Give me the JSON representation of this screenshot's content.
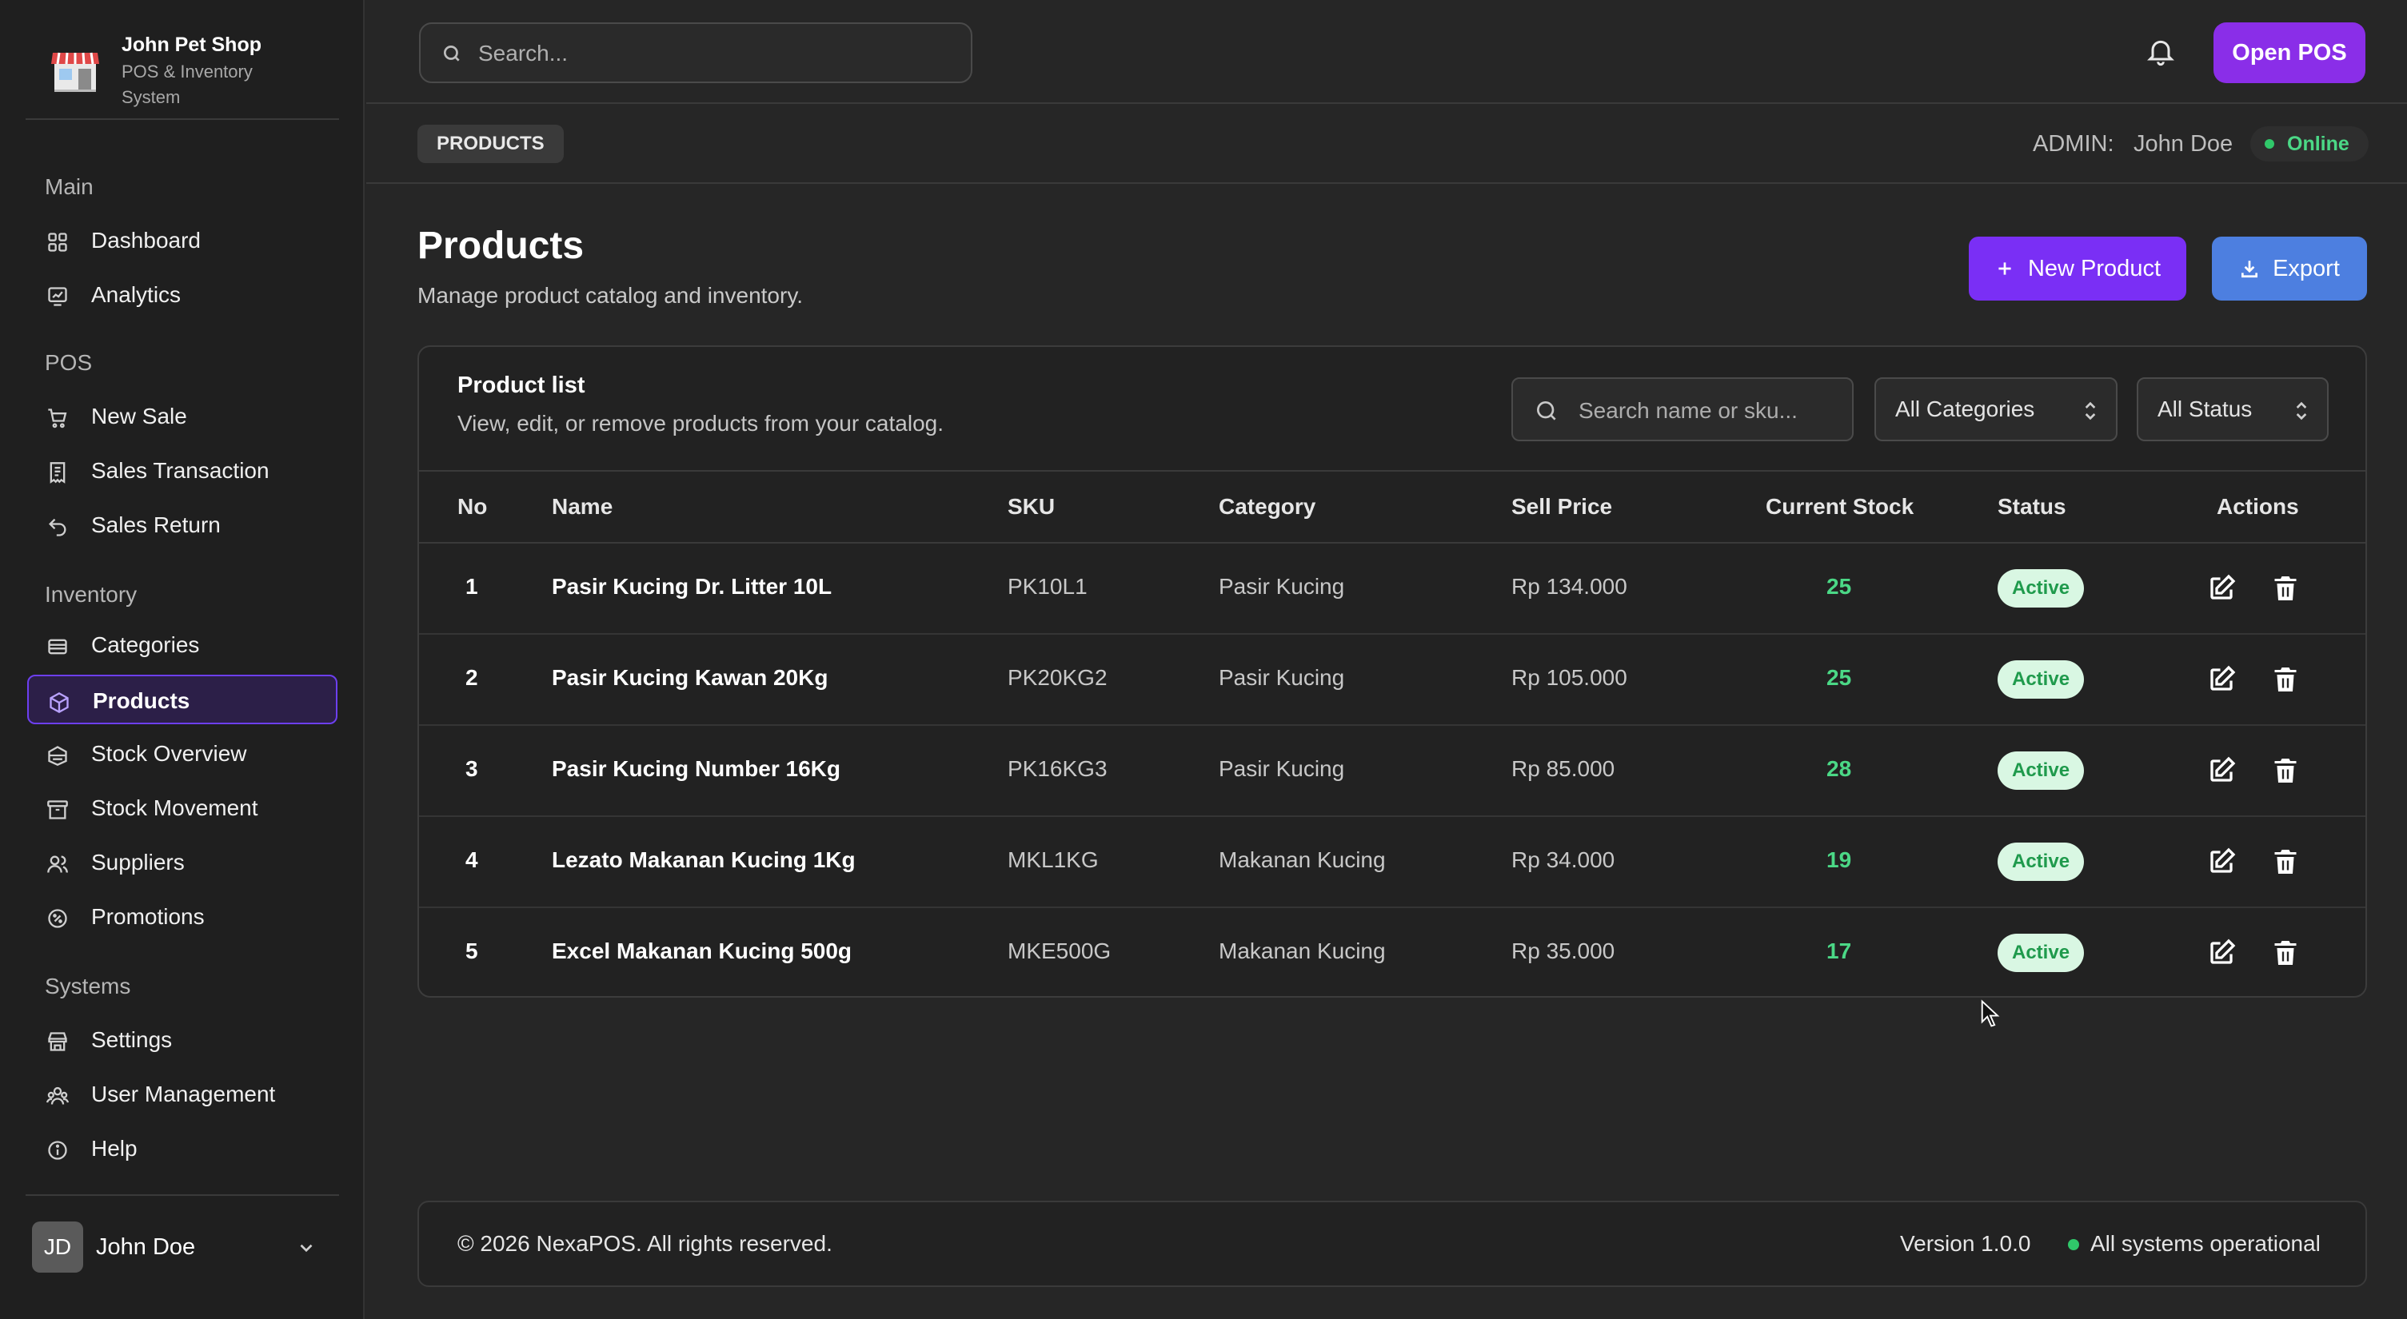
{
  "brand": {
    "name": "John Pet Shop",
    "subtitle": "POS & Inventory System"
  },
  "sidebar": {
    "sections": [
      {
        "label": "Main"
      },
      {
        "label": "POS"
      },
      {
        "label": "Inventory"
      },
      {
        "label": "Systems"
      }
    ],
    "items": [
      {
        "label": "Dashboard",
        "icon": "dashboard-icon"
      },
      {
        "label": "Analytics",
        "icon": "analytics-icon"
      },
      {
        "label": "New Sale",
        "icon": "cart-icon"
      },
      {
        "label": "Sales Transaction",
        "icon": "receipt-icon"
      },
      {
        "label": "Sales Return",
        "icon": "return-icon"
      },
      {
        "label": "Categories",
        "icon": "categories-icon"
      },
      {
        "label": "Products",
        "icon": "box-icon",
        "active": true
      },
      {
        "label": "Stock Overview",
        "icon": "stock-icon"
      },
      {
        "label": "Stock Movement",
        "icon": "archive-icon"
      },
      {
        "label": "Suppliers",
        "icon": "users-icon"
      },
      {
        "label": "Promotions",
        "icon": "percent-badge-icon"
      },
      {
        "label": "Settings",
        "icon": "store-icon"
      },
      {
        "label": "User Management",
        "icon": "user-group-icon"
      },
      {
        "label": "Help",
        "icon": "info-icon"
      }
    ],
    "user": {
      "initials": "JD",
      "name": "John Doe"
    }
  },
  "topbar": {
    "search_placeholder": "Search...",
    "open_pos_label": "Open POS"
  },
  "subbar": {
    "breadcrumb": "PRODUCTS",
    "admin_label": "ADMIN:",
    "admin_name": "John Doe",
    "status": "Online"
  },
  "page": {
    "title": "Products",
    "subtitle": "Manage product catalog and inventory.",
    "new_product_label": "New Product",
    "export_label": "Export"
  },
  "card": {
    "title": "Product list",
    "subtitle": "View, edit, or remove products from your catalog.",
    "search_placeholder": "Search name or sku...",
    "category_filter": "All Categories",
    "status_filter": "All Status"
  },
  "table": {
    "columns": [
      "No",
      "Name",
      "SKU",
      "Category",
      "Sell Price",
      "Current Stock",
      "Status",
      "Actions"
    ],
    "rows": [
      {
        "no": "1",
        "name": "Pasir Kucing Dr. Litter 10L",
        "sku": "PK10L1",
        "category": "Pasir Kucing",
        "price": "Rp 134.000",
        "stock": "25",
        "status": "Active"
      },
      {
        "no": "2",
        "name": "Pasir Kucing Kawan 20Kg",
        "sku": "PK20KG2",
        "category": "Pasir Kucing",
        "price": "Rp 105.000",
        "stock": "25",
        "status": "Active"
      },
      {
        "no": "3",
        "name": "Pasir Kucing Number 16Kg",
        "sku": "PK16KG3",
        "category": "Pasir Kucing",
        "price": "Rp 85.000",
        "stock": "28",
        "status": "Active"
      },
      {
        "no": "4",
        "name": "Lezato Makanan Kucing 1Kg",
        "sku": "MKL1KG",
        "category": "Makanan Kucing",
        "price": "Rp 34.000",
        "stock": "19",
        "status": "Active"
      },
      {
        "no": "5",
        "name": "Excel Makanan Kucing 500g",
        "sku": "MKE500G",
        "category": "Makanan Kucing",
        "price": "Rp 35.000",
        "stock": "17",
        "status": "Active"
      }
    ]
  },
  "footer": {
    "copyright": "© 2026 NexaPOS. All rights reserved.",
    "version": "Version 1.0.0",
    "system_status": "All systems operational"
  },
  "colors": {
    "accent": "#7a2ff5",
    "open_pos": "#8a2ee8",
    "export": "#4d7fe0",
    "success": "#30c86a",
    "background": "#262626"
  }
}
